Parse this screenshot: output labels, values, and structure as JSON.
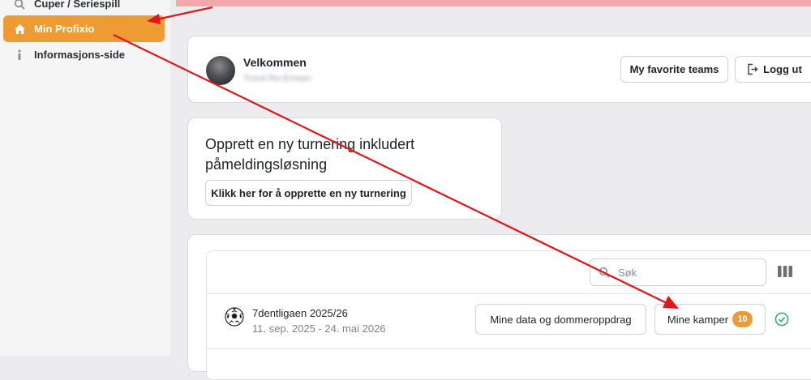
{
  "sidebar": {
    "items": [
      {
        "label": "Cuper / Seriespill",
        "icon": "search-icon"
      },
      {
        "label": "Min Profixio",
        "icon": "home-icon",
        "active": true
      },
      {
        "label": "Informasjons-side",
        "icon": "info-icon"
      }
    ]
  },
  "welcome": {
    "title": "Velkommen",
    "subtitle": "Trond Re-Ernsen",
    "favorite_teams_label": "My favorite teams",
    "logout_label": "Logg ut"
  },
  "create": {
    "title": "Opprett en ny turnering inkludert påmeldingsløsning",
    "button_label": "Klikk her for å opprette en ny turnering"
  },
  "tournaments": {
    "search_placeholder": "Søk",
    "rows": [
      {
        "name": "7dentligaen 2025/26",
        "dates": "11. sep. 2025 - 24. mai 2026",
        "data_button": "Mine data og dommeroppdrag",
        "matches_button": "Mine kamper",
        "matches_count": "10"
      }
    ]
  },
  "colors": {
    "accent": "#ee9b33",
    "annotation_arrow": "#e0161a",
    "alert_banner": "#f3a9ab"
  }
}
